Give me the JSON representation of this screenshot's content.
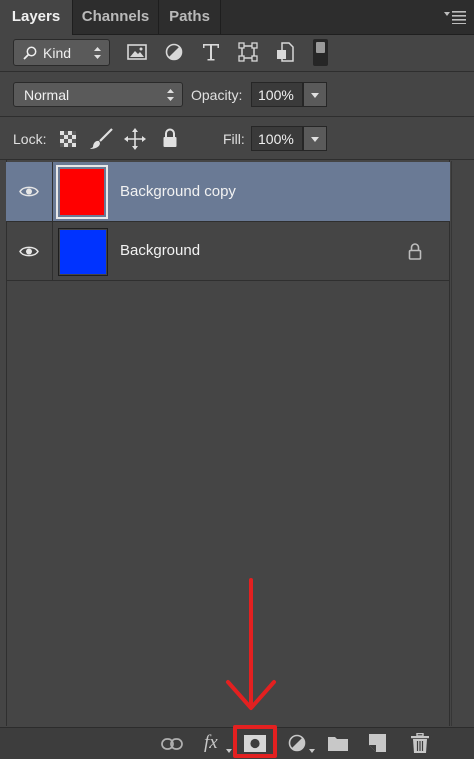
{
  "tabs": [
    {
      "label": "Layers",
      "active": true
    },
    {
      "label": "Channels",
      "active": false
    },
    {
      "label": "Paths",
      "active": false
    }
  ],
  "filter": {
    "label": "Kind"
  },
  "blend_mode": {
    "value": "Normal"
  },
  "opacity": {
    "label": "Opacity:",
    "value": "100%"
  },
  "lock": {
    "label": "Lock:"
  },
  "fill": {
    "label": "Fill:",
    "value": "100%"
  },
  "layers": [
    {
      "name": "Background copy",
      "color": "#ff0000",
      "selected": true,
      "locked": false
    },
    {
      "name": "Background",
      "color": "#0033ff",
      "selected": false,
      "locked": true
    }
  ],
  "colors": {
    "selected_row": "#6a7a95",
    "annotation": "#e32020"
  },
  "bottom_bar": {
    "fx_label": "fx",
    "icons": [
      "link-layers-icon",
      "fx-icon",
      "add-mask-icon",
      "adjustment-layer-icon",
      "new-group-icon",
      "new-layer-icon",
      "delete-layer-icon"
    ]
  }
}
